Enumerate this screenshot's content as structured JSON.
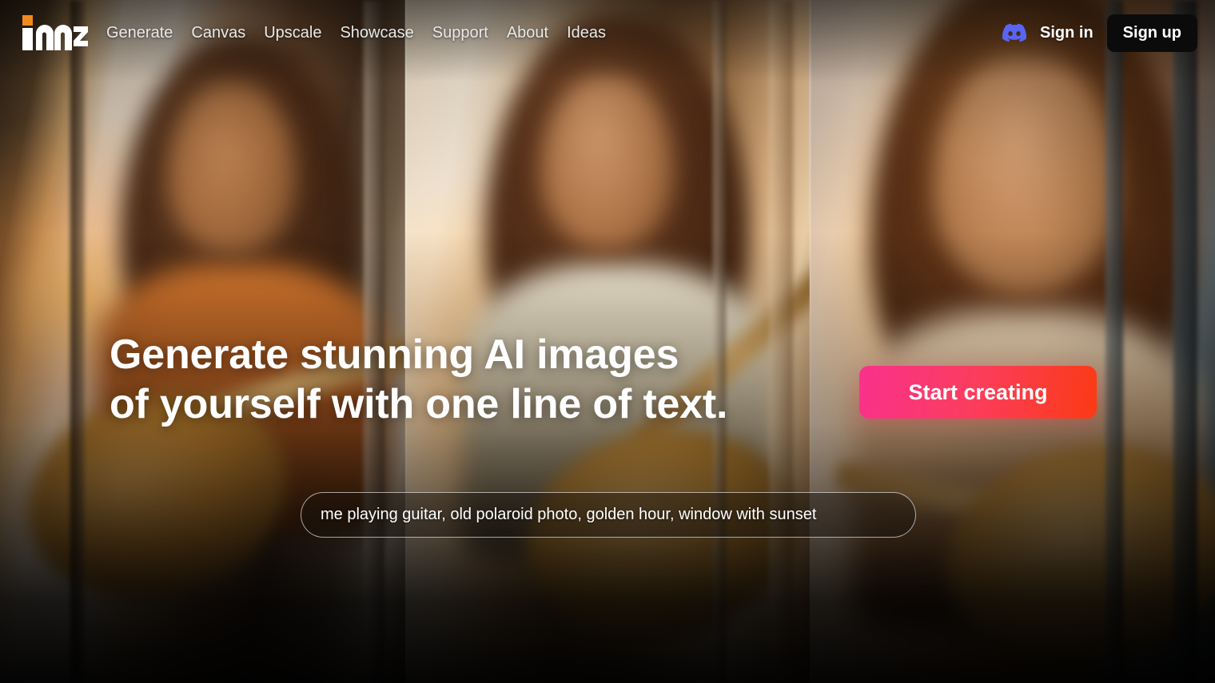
{
  "brand": {
    "logo_text": "imz",
    "accent_color": "#F18A1E",
    "logo_color": "#FFFFFF"
  },
  "header": {
    "nav": [
      {
        "label": "Generate"
      },
      {
        "label": "Canvas"
      },
      {
        "label": "Upscale"
      },
      {
        "label": "Showcase"
      },
      {
        "label": "Support"
      },
      {
        "label": "About"
      },
      {
        "label": "Ideas"
      }
    ],
    "discord_icon": "discord-icon",
    "discord_color": "#5865F2",
    "sign_in_label": "Sign in",
    "sign_up_label": "Sign up",
    "sign_up_bg": "#0B0B0B"
  },
  "hero": {
    "headline_line1": "Generate stunning AI images",
    "headline_line2": "of yourself with one line of text.",
    "cta_label": "Start creating",
    "cta_gradient_start": "#F9318C",
    "cta_gradient_end": "#FB3A14",
    "prompt_value": "me playing guitar, old polaroid photo, golden hour, window with sunset",
    "prompt_placeholder": "me playing guitar, old polaroid photo, golden hour, window with sunset"
  },
  "background": {
    "description": "Three-panel golden-hour photo triptych of a young woman with long hair playing an acoustic guitar beside a sunlit window",
    "panels": [
      {
        "name": "panel-left",
        "subject": "woman with guitar, wide shot, orange tee, backlit window"
      },
      {
        "name": "panel-center",
        "subject": "woman with guitar, medium shot, cream tee, sunset through window"
      },
      {
        "name": "panel-right",
        "subject": "woman with guitar, close-up portrait, warm rim light"
      }
    ]
  }
}
